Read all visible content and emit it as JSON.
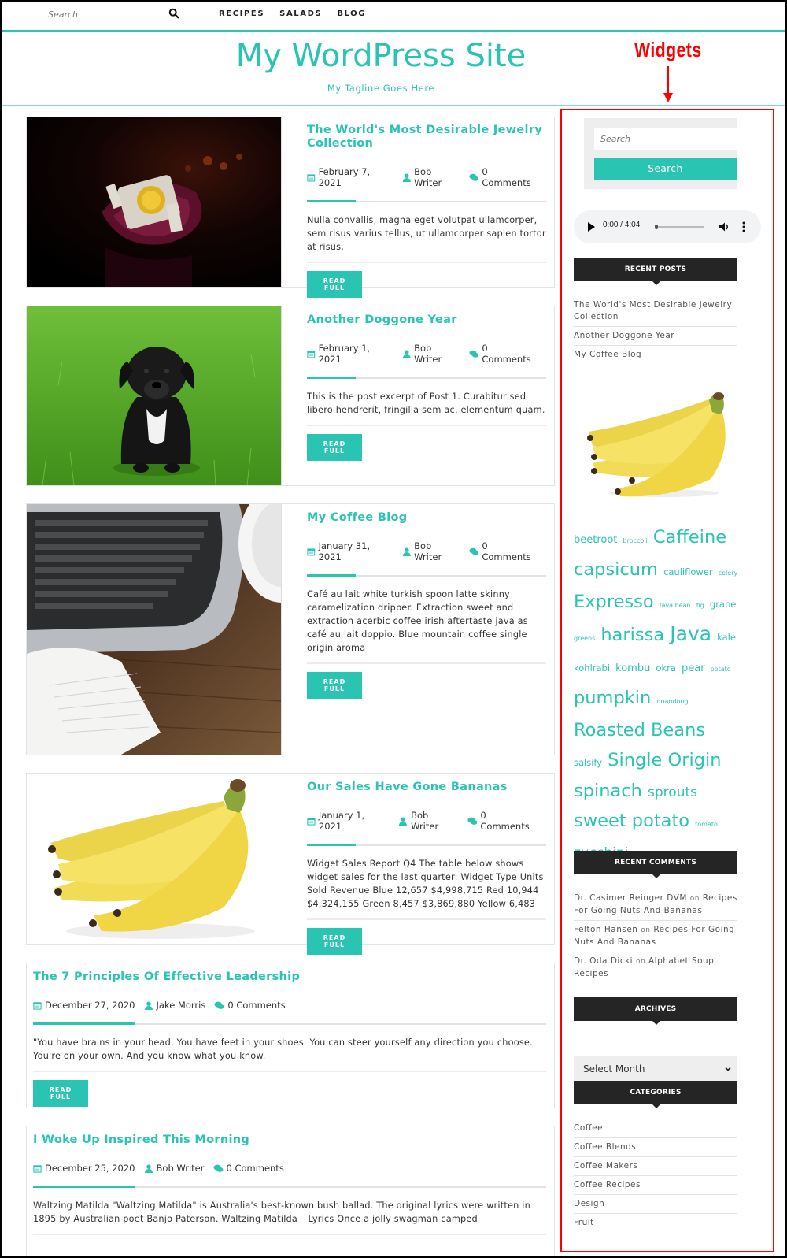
{
  "topbar": {
    "search_placeholder": "Search",
    "search_icon": "search-icon",
    "nav": [
      "RECIPES",
      "SALADS",
      "BLOG"
    ]
  },
  "header": {
    "title": "My WordPress Site",
    "tagline": "My Tagline Goes Here"
  },
  "annotation": {
    "label": "Widgets",
    "color": "#ff0000"
  },
  "theme": {
    "accent": "#2ac4b3",
    "widget_title_bg": "#252525"
  },
  "posts": [
    {
      "title": "The World's Most Desirable Jewelry Collection",
      "date": "February 7, 2021",
      "author": "Bob Writer",
      "comments": "0 Comments",
      "excerpt": "Nulla convallis, magna eget volutpat ullamcorper, sem risus varius tellus, ut ullamcorper sapien tortor at risus.",
      "button": "READ FULL",
      "image": "jewelry-bracelet"
    },
    {
      "title": "Another Doggone Year",
      "date": "February 1, 2021",
      "author": "Bob Writer",
      "comments": "0 Comments",
      "excerpt": "This is the post excerpt of Post 1. Curabitur sed libero hendrerit, fringilla sem ac, elementum quam.",
      "button": "READ FULL",
      "image": "puppy-on-grass"
    },
    {
      "title": "My Coffee Blog",
      "date": "January 31, 2021",
      "author": "Bob Writer",
      "comments": "0 Comments",
      "excerpt": "Café au lait white turkish spoon latte skinny caramelization dripper. Extraction sweet and extraction acerbic coffee irish aftertaste java as café au lait doppio. Blue mountain coffee single origin aroma",
      "button": "READ FULL",
      "image": "laptop-notebook-desk"
    },
    {
      "title": "Our Sales Have Gone Bananas",
      "date": "January 1, 2021",
      "author": "Bob Writer",
      "comments": "0 Comments",
      "excerpt": "Widget Sales Report Q4 The table below shows widget sales for the last quarter: Widget Type Units Sold Revenue Blue 12,657 $4,998,715 Red 10,944 $4,324,155 Green 8,457 $3,869,880 Yellow 6,483",
      "button": "READ FULL",
      "image": "bananas"
    },
    {
      "title": "The 7 Principles Of Effective Leadership",
      "date": "December 27, 2020",
      "author": "Jake Morris",
      "comments": "0 Comments",
      "excerpt": "\"You have brains in your head. You have feet in your shoes. You can steer yourself any direction you choose. You're on your own. And you know what you know.",
      "button": "READ FULL"
    },
    {
      "title": "I Woke Up Inspired This Morning",
      "date": "December 25, 2020",
      "author": "Bob Writer",
      "comments": "0 Comments",
      "excerpt": "Waltzing Matilda \"Waltzing Matilda\" is Australia's best-known bush ballad. The original lyrics were written in 1895 by Australian poet Banjo Paterson. Waltzing Matilda – Lyrics Once a jolly swagman camped"
    }
  ],
  "sidebar": {
    "search": {
      "placeholder": "Search",
      "button": "Search"
    },
    "audio": {
      "time": "0:00 / 4:04",
      "progress": 0
    },
    "recent_posts": {
      "title": "RECENT POSTS",
      "items": [
        "The World's Most Desirable Jewelry Collection",
        "Another Doggone Year",
        "My Coffee Blog"
      ]
    },
    "image": "bananas",
    "tag_cloud": [
      {
        "t": "beetroot",
        "s": 2
      },
      {
        "t": "broccoli",
        "s": 0
      },
      {
        "t": "Caffeine",
        "s": 5
      },
      {
        "t": "capsicum",
        "s": 5
      },
      {
        "t": "cauliflower",
        "s": 1
      },
      {
        "t": "celery",
        "s": 0
      },
      {
        "t": "Expresso",
        "s": 5
      },
      {
        "t": "fava bean",
        "s": 0
      },
      {
        "t": "fig",
        "s": 0
      },
      {
        "t": "grape",
        "s": 1
      },
      {
        "t": "greens",
        "s": 0
      },
      {
        "t": "harissa",
        "s": 5
      },
      {
        "t": "Java",
        "s": 6
      },
      {
        "t": "kale",
        "s": 1
      },
      {
        "t": "kohlrabi",
        "s": 1
      },
      {
        "t": "kombu",
        "s": 2
      },
      {
        "t": "okra",
        "s": 1
      },
      {
        "t": "pear",
        "s": 2
      },
      {
        "t": "potato",
        "s": 0
      },
      {
        "t": "pumpkin",
        "s": 5
      },
      {
        "t": "quandong",
        "s": 0
      },
      {
        "t": "Roasted Beans",
        "s": 5
      },
      {
        "t": "salsify",
        "s": 1
      },
      {
        "t": "Single Origin",
        "s": 5
      },
      {
        "t": "spinach",
        "s": 5
      },
      {
        "t": "sprouts",
        "s": 3
      },
      {
        "t": "sweet potato",
        "s": 5
      },
      {
        "t": "tomato",
        "s": 0
      },
      {
        "t": "zucchini",
        "s": 3
      }
    ],
    "recent_comments": {
      "title": "RECENT COMMENTS",
      "items": [
        {
          "author": "Dr. Casimer Reinger DVM",
          "on": "on",
          "post": "Recipes For Going Nuts And Bananas"
        },
        {
          "author": "Felton Hansen",
          "on": "on",
          "post": "Recipes For Going Nuts And Bananas"
        },
        {
          "author": "Dr. Oda Dicki",
          "on": "on",
          "post": "Alphabet Soup Recipes"
        }
      ]
    },
    "archives": {
      "title": "ARCHIVES",
      "selected": "Select Month"
    },
    "categories": {
      "title": "CATEGORIES",
      "items": [
        "Coffee",
        "Coffee Blends",
        "Coffee Makers",
        "Coffee Recipes",
        "Design",
        "Fruit"
      ]
    }
  }
}
